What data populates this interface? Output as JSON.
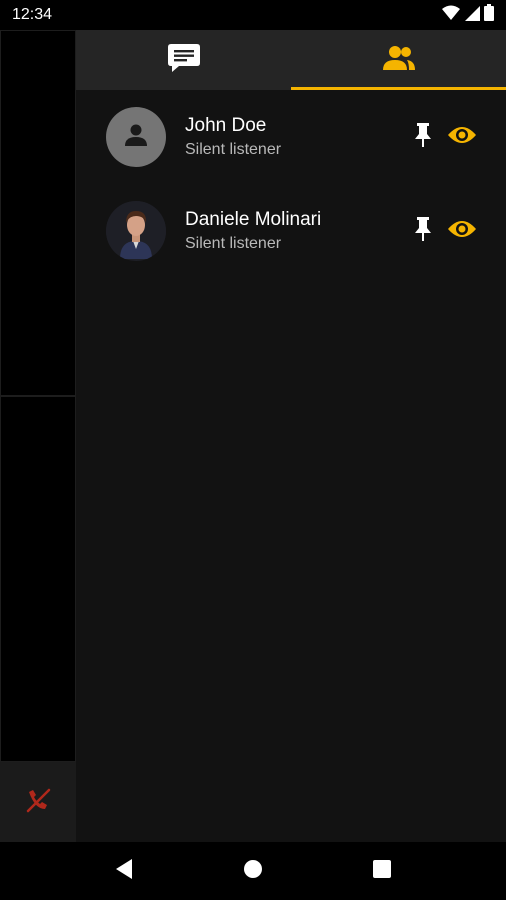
{
  "status_bar": {
    "time": "12:34",
    "icons": [
      "wifi-icon",
      "signal-icon",
      "battery-icon"
    ]
  },
  "tabs": [
    {
      "icon": "chat-icon",
      "active": false
    },
    {
      "icon": "participants-icon",
      "active": true
    }
  ],
  "participants": [
    {
      "name": "John Doe",
      "role": "Silent listener",
      "avatar": "person-placeholder-icon"
    },
    {
      "name": "Daniele Molinari",
      "role": "Silent listener",
      "avatar": "profile-photo"
    }
  ],
  "call_controls": {
    "hangup_icon": "call-end-icon"
  },
  "nav_bar": {
    "icons": [
      "back-icon",
      "home-icon",
      "recents-icon"
    ]
  },
  "colors": {
    "accent": "#f5b400",
    "background": "#121212",
    "tab_bar": "#252525",
    "hangup": "#b0281b",
    "subtitle": "#b9b9b9"
  }
}
